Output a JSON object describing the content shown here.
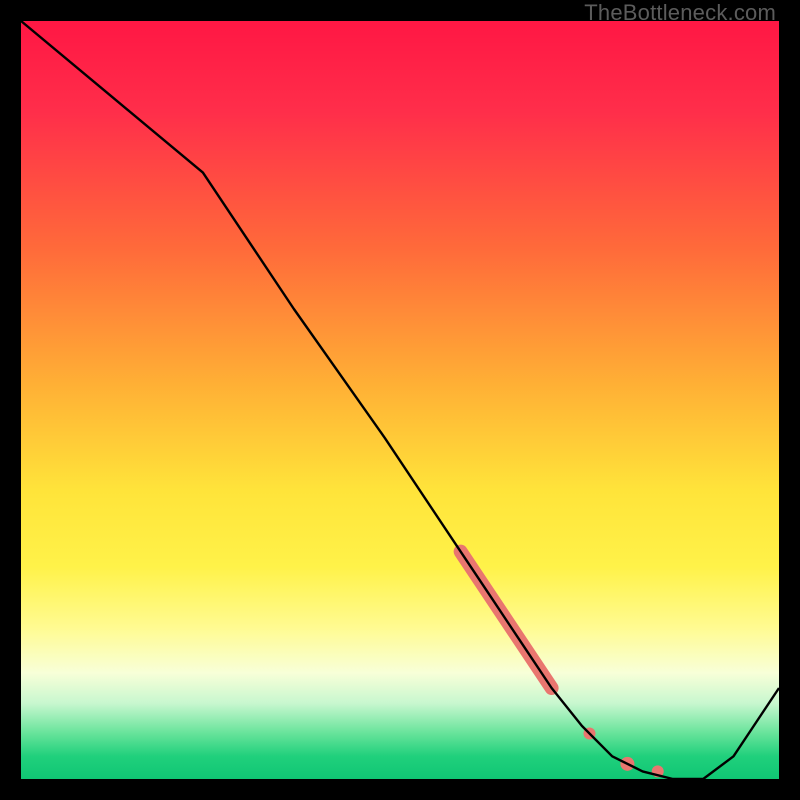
{
  "watermark": "TheBottleneck.com",
  "chart_data": {
    "type": "line",
    "title": "",
    "xlabel": "",
    "ylabel": "",
    "xlim": [
      0,
      100
    ],
    "ylim": [
      0,
      100
    ],
    "grid": false,
    "series": [
      {
        "name": "curve",
        "color": "#000000",
        "x": [
          0,
          12,
          24,
          36,
          48,
          58,
          62,
          66,
          70,
          74,
          78,
          82,
          86,
          90,
          94,
          100
        ],
        "y": [
          100,
          90,
          80,
          62,
          45,
          30,
          24,
          18,
          12,
          7,
          3,
          1,
          0,
          0,
          3,
          12
        ]
      }
    ],
    "markers": [
      {
        "name": "thick-segment",
        "type": "line-segment",
        "color": "#e9766f",
        "width": 14,
        "x": [
          58,
          70
        ],
        "y": [
          30,
          12
        ]
      },
      {
        "name": "dot-1",
        "type": "point",
        "color": "#e9766f",
        "radius": 6,
        "x": 75,
        "y": 6
      },
      {
        "name": "dot-2",
        "type": "point",
        "color": "#e9766f",
        "radius": 7,
        "x": 80,
        "y": 2
      },
      {
        "name": "dot-3",
        "type": "point",
        "color": "#e9766f",
        "radius": 6,
        "x": 84,
        "y": 1
      }
    ]
  }
}
